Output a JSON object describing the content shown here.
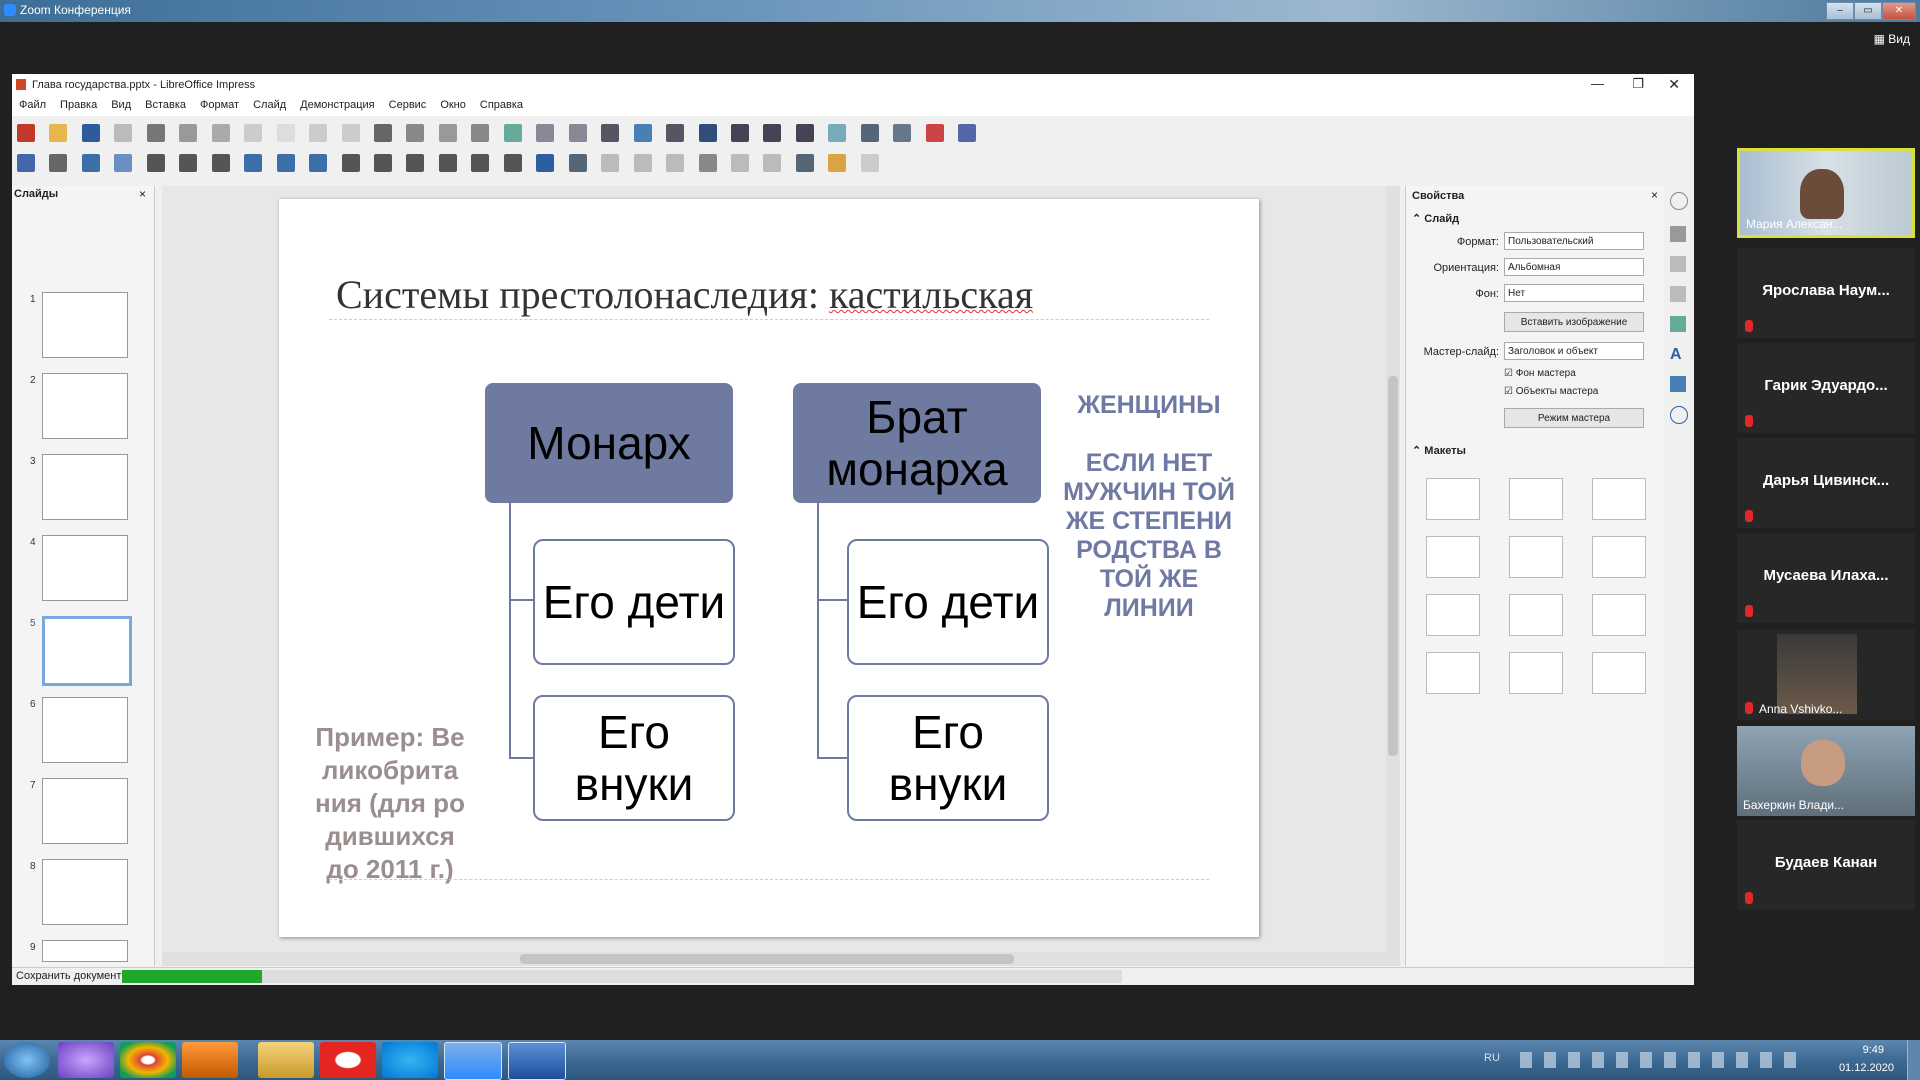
{
  "zoom": {
    "window_title": "Zoom Конференция",
    "view_label": "Вид",
    "participants": [
      {
        "name": "Мария Алексан...",
        "video": true
      },
      {
        "name": "Ярослава Наум...",
        "video": false
      },
      {
        "name": "Гарик Эдуардо...",
        "video": false
      },
      {
        "name": "Дарья Цивинск...",
        "video": false
      },
      {
        "name": "Мусаева Илаха...",
        "video": false
      },
      {
        "name": "Anna Vshivko...",
        "video": true
      },
      {
        "name": "Бахеркин Влади...",
        "video": true
      },
      {
        "name": "Будаев Канан",
        "video": false
      }
    ]
  },
  "libreoffice": {
    "window_title": "Глава государства.pptx - LibreOffice Impress",
    "menu": [
      "Файл",
      "Правка",
      "Вид",
      "Вставка",
      "Формат",
      "Слайд",
      "Демонстрация",
      "Сервис",
      "Окно",
      "Справка"
    ],
    "slides_panel_title": "Слайды",
    "slide_numbers": [
      "1",
      "2",
      "3",
      "4",
      "5",
      "6",
      "7",
      "8",
      "9"
    ],
    "selected_slide": 5,
    "status_text": "Сохранить документ",
    "save_progress": 0.14
  },
  "slide": {
    "title_prefix": "Системы престолонаследия: ",
    "title_word": "кастильская",
    "box_monarch": "Монарх",
    "box_brother": "Брат монарха",
    "box_children_1": "Его дети",
    "box_grandchildren_1": "Его внуки",
    "box_children_2": "Его дети",
    "box_grandchildren_2": "Его внуки",
    "note_women": "ЖЕНЩИНЫ",
    "note_condition": "ЕСЛИ НЕТ МУЖЧИН ТОЙ ЖЕ СТЕПЕНИ РОДСТВА В ТОЙ ЖЕ ЛИНИИ",
    "example": "Пример: Великобритания (для родившихся до 2011 г.)"
  },
  "sidebar": {
    "title": "Свойства",
    "section_slide": "Слайд",
    "format_label": "Формат:",
    "format_value": "Пользовательский",
    "orientation_label": "Ориентация:",
    "orientation_value": "Альбомная",
    "background_label": "Фон:",
    "background_value": "Нет",
    "insert_image_button": "Вставить изображение",
    "master_slide_label": "Мастер-слайд:",
    "master_slide_value": "Заголовок и объект",
    "master_background_check": "Фон мастера",
    "master_objects_check": "Объекты мастера",
    "master_mode_button": "Режим мастера",
    "section_layouts": "Макеты"
  },
  "taskbar": {
    "language": "RU",
    "time": "9:49",
    "date": "01.12.2020"
  },
  "colors": {
    "diagram_box": "#6f7aa1",
    "example_text": "#9b8e8e",
    "notes_text": "#7079a3"
  }
}
